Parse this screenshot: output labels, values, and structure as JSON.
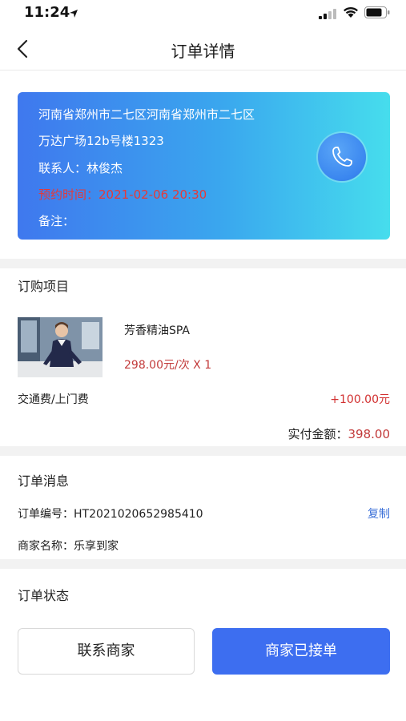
{
  "status_bar": {
    "time": "11:24",
    "icons": [
      "location-arrow-icon",
      "cellular-signal-icon",
      "wifi-icon",
      "battery-icon"
    ]
  },
  "navbar": {
    "title": "订单详情",
    "back_icon": "chevron-left-icon"
  },
  "address_card": {
    "line1": "河南省郑州市二七区河南省郑州市二七区",
    "line2": "万达广场12b号楼1323",
    "contact": "联系人：林俊杰",
    "appointment": "预约时间：2021-02-06 20:30",
    "note": "备注：",
    "phone_icon": "phone-icon",
    "gradient_start": "#3f78ee",
    "gradient_end": "#46dded",
    "appointment_color": "#e53a3a"
  },
  "order_items": {
    "title": "订购项目",
    "items": [
      {
        "name": "芳香精油SPA",
        "price": "298.00元/次 X 1"
      }
    ],
    "fee_label": "交通费/上门费",
    "fee_value": "+100.00元",
    "total_label": "实付金额：",
    "total_amount": "398.00"
  },
  "order_info": {
    "title": "订单消息",
    "order_no": "订单编号：HT2021020652985410",
    "copy_label": "复制",
    "merchant": "商家名称：乐享到家"
  },
  "order_status": {
    "title": "订单状态"
  },
  "actions": {
    "contact_label": "联系商家",
    "status_label": "商家已接单",
    "primary_color": "#3d6ef0"
  }
}
